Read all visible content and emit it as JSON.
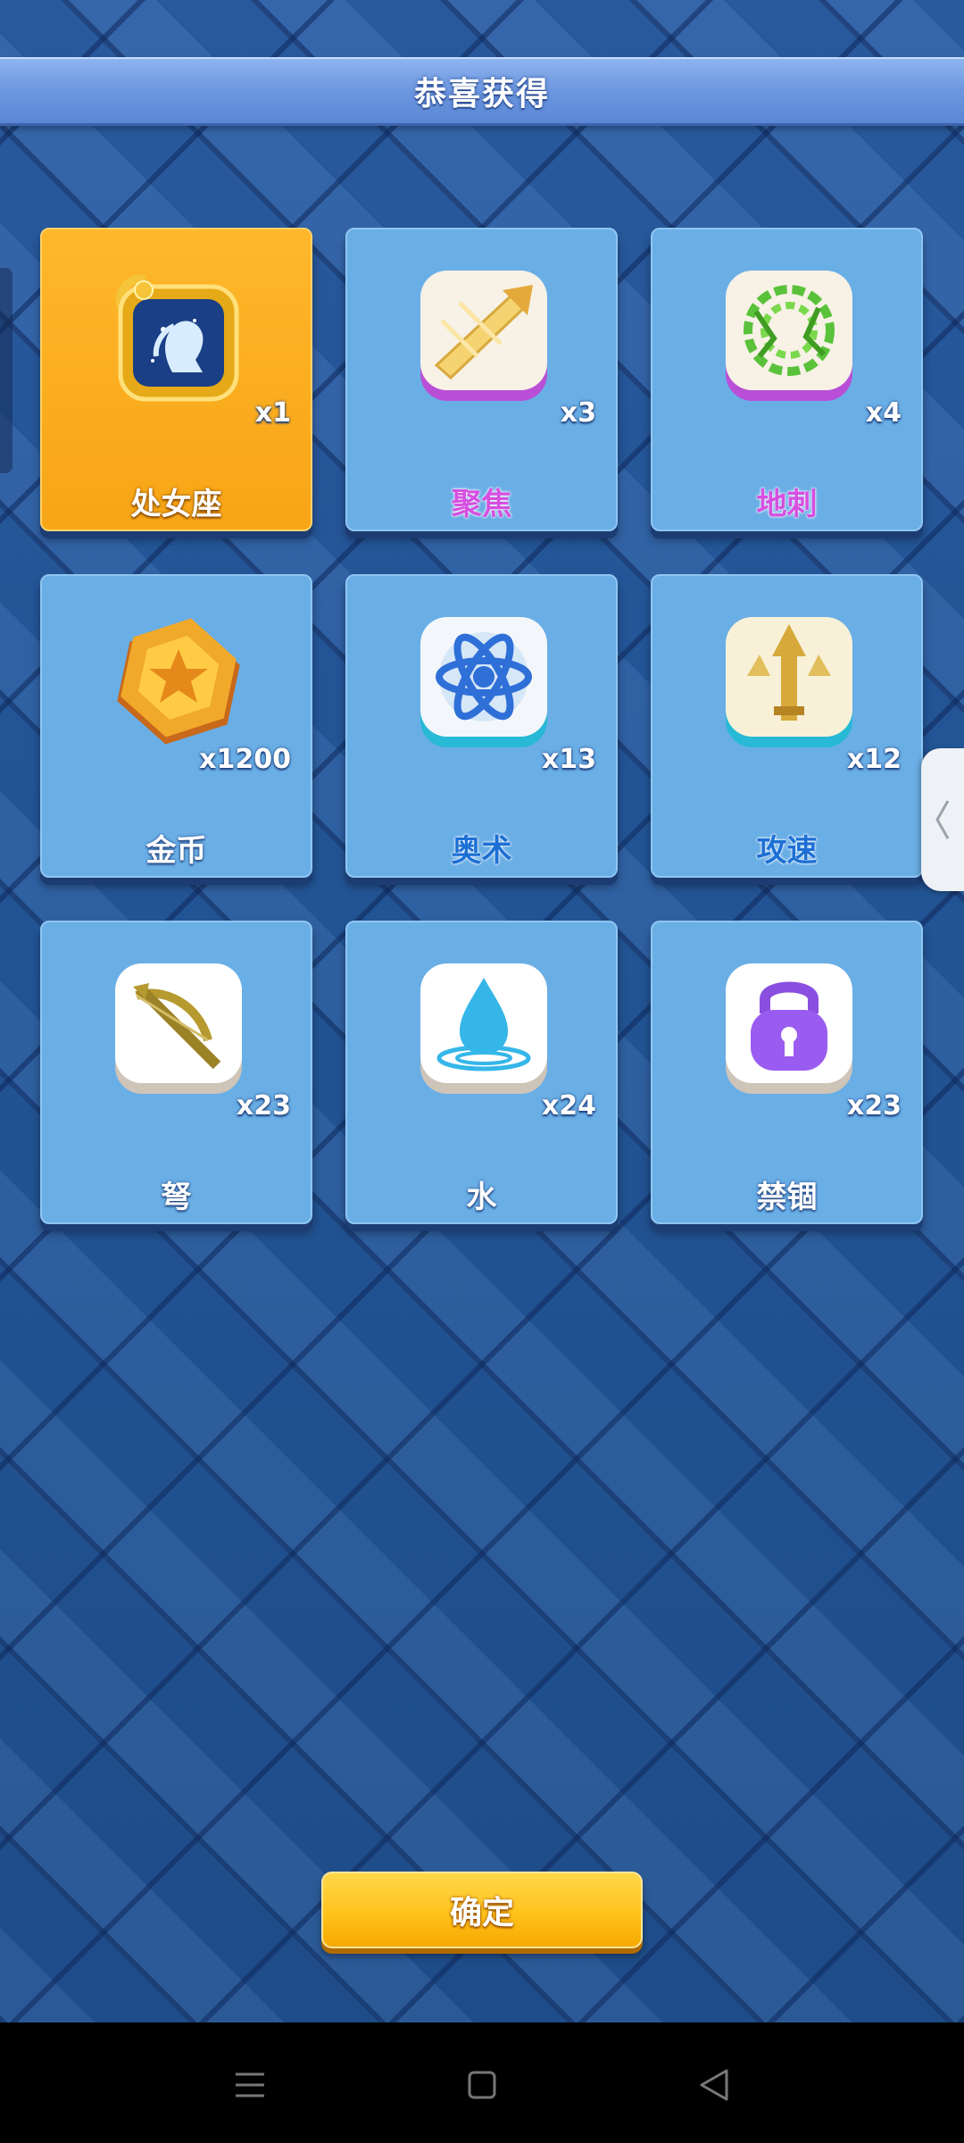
{
  "header": {
    "title": "恭喜获得"
  },
  "rewards": [
    {
      "name": "处女座",
      "count": "x1",
      "icon": "virgo-constellation-icon"
    },
    {
      "name": "聚焦",
      "count": "x3",
      "icon": "focus-icon"
    },
    {
      "name": "地刺",
      "count": "x4",
      "icon": "thorns-icon"
    },
    {
      "name": "金币",
      "count": "x1200",
      "icon": "gold-coin-icon"
    },
    {
      "name": "奥术",
      "count": "x13",
      "icon": "arcane-icon"
    },
    {
      "name": "攻速",
      "count": "x12",
      "icon": "attack-speed-icon"
    },
    {
      "name": "弩",
      "count": "x23",
      "icon": "crossbow-icon"
    },
    {
      "name": "水",
      "count": "x24",
      "icon": "water-drop-icon"
    },
    {
      "name": "禁锢",
      "count": "x23",
      "icon": "lock-icon"
    }
  ],
  "confirm": {
    "label": "确定"
  },
  "colors": {
    "accent_gold": "#ffb72b",
    "card_blue": "#6aaee6",
    "title_bar": "#6c97e0"
  },
  "system_nav": {
    "icons": [
      "menu-icon",
      "home-icon",
      "back-icon"
    ]
  }
}
